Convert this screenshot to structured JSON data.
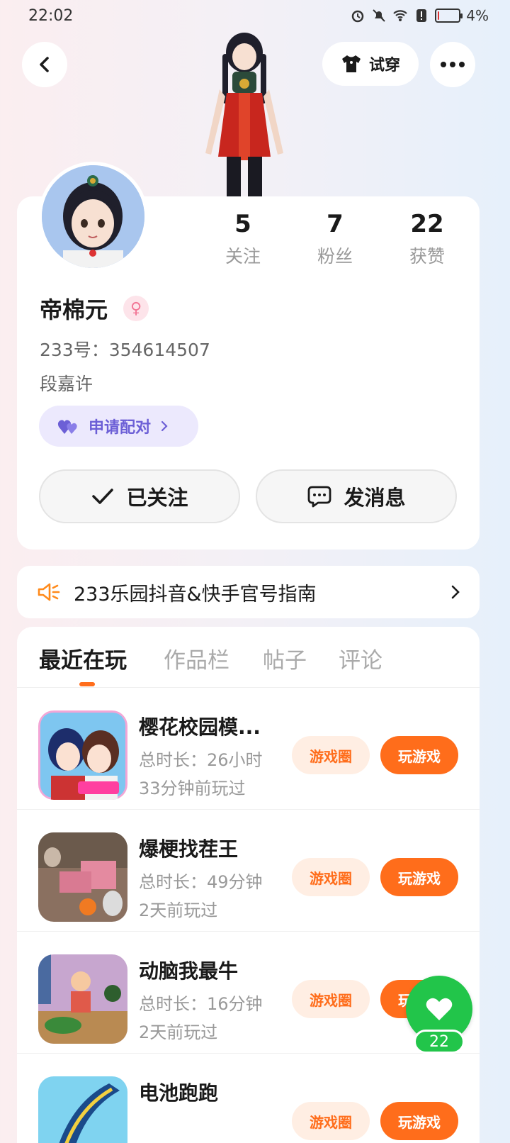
{
  "status_bar": {
    "time": "22:02",
    "battery_text": "4%",
    "battery_level": 0.04,
    "icons": [
      "alarm-icon",
      "mute-icon",
      "wifi-icon",
      "alert-icon",
      "battery-icon"
    ]
  },
  "header": {
    "tryon_label": "试穿"
  },
  "profile": {
    "stats": [
      {
        "value": "5",
        "label": "关注"
      },
      {
        "value": "7",
        "label": "粉丝"
      },
      {
        "value": "22",
        "label": "获赞"
      }
    ],
    "name": "帝棉元",
    "gender_symbol": "♀",
    "id_text": "233号：354614507",
    "bio": "段嘉许",
    "pair_label": "申请配对",
    "follow_label": "已关注",
    "message_label": "发消息"
  },
  "notice": {
    "text": "233乐园抖音&快手官号指南"
  },
  "tabs": [
    {
      "label": "最近在玩",
      "active": true
    },
    {
      "label": "作品栏",
      "active": false
    },
    {
      "label": "帖子",
      "active": false
    },
    {
      "label": "评论",
      "active": false
    }
  ],
  "games": [
    {
      "title": "樱花校园模...",
      "duration": "总时长：26小时",
      "played": "33分钟前玩过",
      "circle_label": "游戏圈",
      "play_label": "玩游戏"
    },
    {
      "title": "爆梗找茬王",
      "duration": "总时长：49分钟",
      "played": "2天前玩过",
      "circle_label": "游戏圈",
      "play_label": "玩游戏"
    },
    {
      "title": "动脑我最牛",
      "duration": "总时长：16分钟",
      "played": "2天前玩过",
      "circle_label": "游戏圈",
      "play_label": "玩游戏"
    },
    {
      "title": "电池跑跑",
      "duration": "",
      "played": "",
      "circle_label": "游戏圈",
      "play_label": "玩游戏"
    }
  ],
  "like": {
    "count": "22"
  },
  "colors": {
    "accent": "#ff6d1b",
    "like_green": "#22c54a",
    "pair_purple": "#6c5fd6"
  }
}
